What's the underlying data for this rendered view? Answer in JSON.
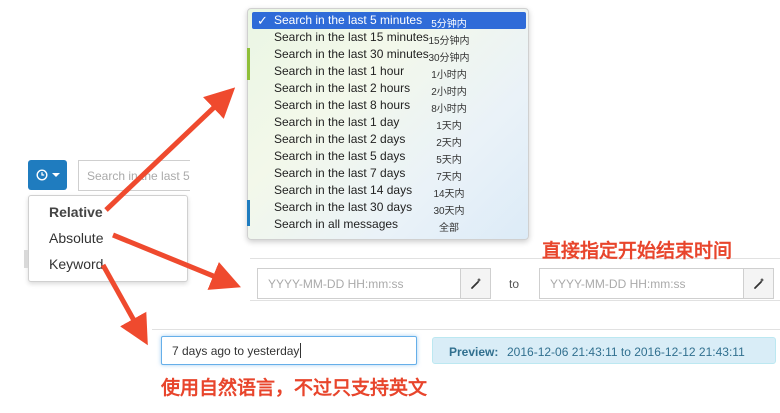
{
  "search": {
    "placeholder_fragment": "Search in the last 5"
  },
  "mode_menu": {
    "items": [
      {
        "label": "Relative",
        "active": true
      },
      {
        "label": "Absolute",
        "active": false
      },
      {
        "label": "Keyword",
        "active": false
      }
    ]
  },
  "relative_menu": {
    "items": [
      {
        "label": "Search in the last 5 minutes",
        "zh": "5分钟内",
        "selected": true
      },
      {
        "label": "Search in the last 15 minutes",
        "zh": "15分钟内",
        "selected": false
      },
      {
        "label": "Search in the last 30 minutes",
        "zh": "30分钟内",
        "selected": false
      },
      {
        "label": "Search in the last 1 hour",
        "zh": "1小时内",
        "selected": false
      },
      {
        "label": "Search in the last 2 hours",
        "zh": "2小时内",
        "selected": false
      },
      {
        "label": "Search in the last 8 hours",
        "zh": "8小时内",
        "selected": false
      },
      {
        "label": "Search in the last 1 day",
        "zh": "1天内",
        "selected": false
      },
      {
        "label": "Search in the last 2 days",
        "zh": "2天内",
        "selected": false
      },
      {
        "label": "Search in the last 5 days",
        "zh": "5天内",
        "selected": false
      },
      {
        "label": "Search in the last 7 days",
        "zh": "7天内",
        "selected": false
      },
      {
        "label": "Search in the last 14 days",
        "zh": "14天内",
        "selected": false
      },
      {
        "label": "Search in the last 30 days",
        "zh": "30天内",
        "selected": false
      },
      {
        "label": "Search in all messages",
        "zh": "全部",
        "selected": false
      }
    ],
    "check_glyph": "✓"
  },
  "absolute": {
    "from_placeholder": "YYYY-MM-DD HH:mm:ss",
    "to_label": "to",
    "to_placeholder": "YYYY-MM-DD HH:mm:ss",
    "picker_icon": "magic-wand-icon"
  },
  "keyword": {
    "value": "7 days ago to yesterday",
    "preview_label": "Preview:",
    "preview_value": "2016-12-06 21:43:11 to 2016-12-12 21:43:11"
  },
  "annotations": {
    "absolute_note": "直接指定开始结束时间",
    "keyword_note": "使用自然语言，不过只支持英文"
  },
  "colors": {
    "primary": "#1f7cbf",
    "selected": "#2f6bd8",
    "annotation": "#e8452c",
    "preview_bg": "#d9edf7",
    "preview_text": "#31708f"
  }
}
